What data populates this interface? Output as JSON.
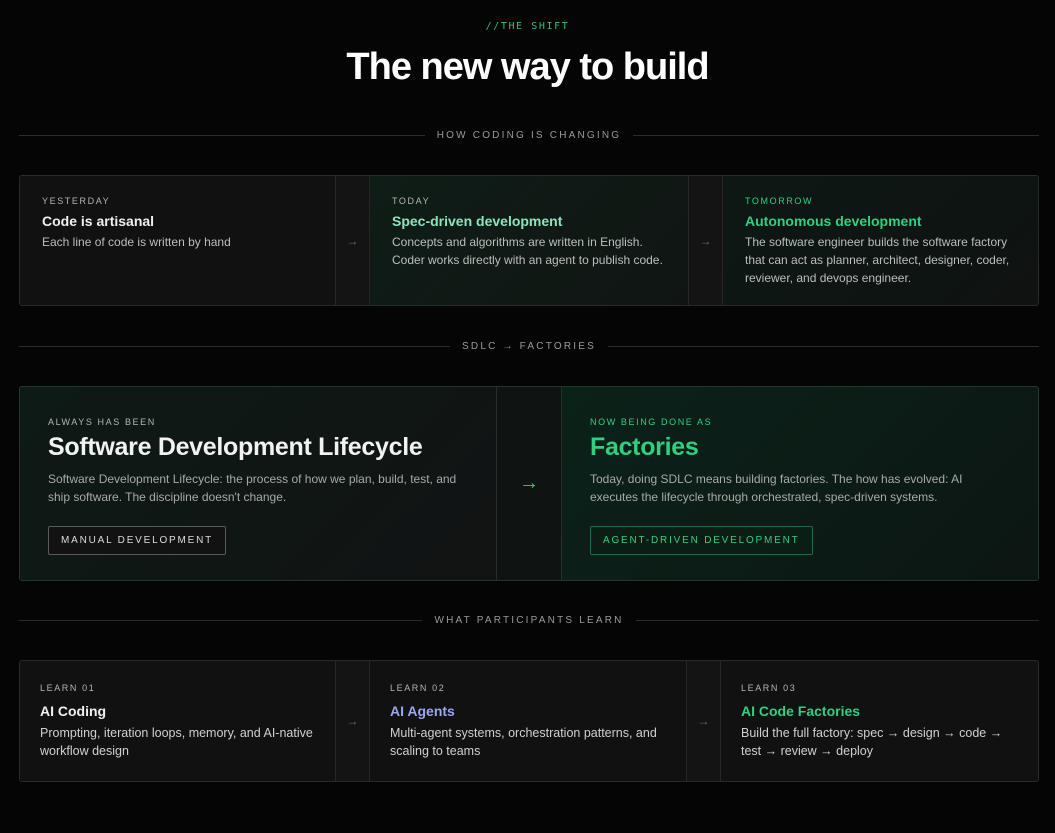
{
  "header": {
    "eyebrow": "//THE SHIFT",
    "title": "The new way to build"
  },
  "section1": {
    "label": "HOW CODING IS CHANGING",
    "stages": [
      {
        "kicker": "YESTERDAY",
        "title": "Code is artisanal",
        "desc": "Each line of code is written by hand"
      },
      {
        "kicker": "TODAY",
        "title": "Spec-driven development",
        "desc": "Concepts and algorithms are written in English. Coder works directly with an agent to publish code."
      },
      {
        "kicker": "TOMORROW",
        "title": "Autonomous development",
        "desc": "The software engineer builds the software factory that can act as planner, architect, designer, coder, reviewer, and devops engineer."
      }
    ]
  },
  "section2": {
    "label": "SDLC → FACTORIES",
    "left": {
      "kicker": "ALWAYS HAS BEEN",
      "title": "Software Development Lifecycle",
      "desc": "Software Development Lifecycle: the process of how we plan, build, test, and ship software. The discipline doesn't change.",
      "pill": "MANUAL DEVELOPMENT"
    },
    "right": {
      "kicker": "NOW BEING DONE AS",
      "title": "Factories",
      "desc": "Today, doing SDLC means building factories. The how has evolved: AI executes the lifecycle through orchestrated, spec-driven systems.",
      "pill": "AGENT-DRIVEN DEVELOPMENT"
    }
  },
  "section3": {
    "label": "WHAT PARTICIPANTS LEARN",
    "items": [
      {
        "kicker": "LEARN 01",
        "title": "AI Coding",
        "desc": "Prompting, iteration loops, memory, and AI-native workflow design"
      },
      {
        "kicker": "LEARN 02",
        "title": "AI Agents",
        "desc": "Multi-agent systems, orchestration patterns, and scaling to teams"
      },
      {
        "kicker": "LEARN 03",
        "title": "AI Code Factories",
        "desc": "Build the full factory: spec → design → code → test → review → deploy"
      }
    ]
  },
  "icons": {
    "arrow": "→"
  },
  "colors": {
    "accent_green": "#2fd07f",
    "mint": "#8fe3b9",
    "lavender": "#9aa6ef",
    "background": "#050505"
  }
}
